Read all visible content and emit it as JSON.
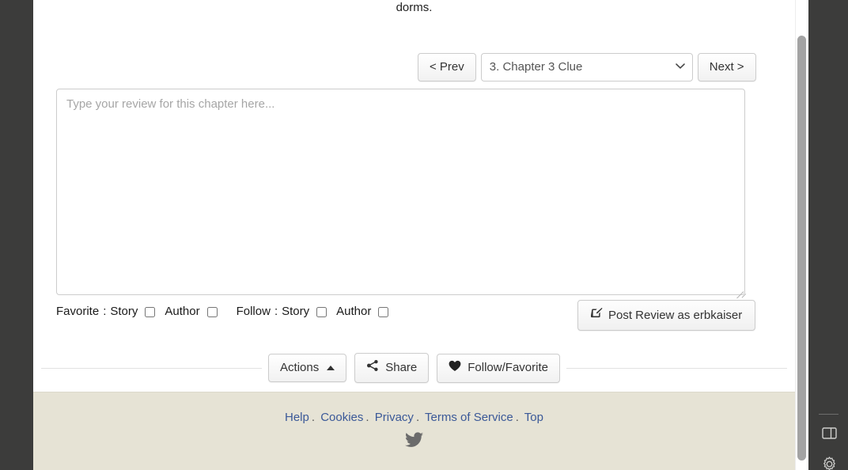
{
  "story": {
    "trailing_text": "dorms."
  },
  "chapter_nav": {
    "prev_label": "< Prev",
    "next_label": "Next >",
    "selected_chapter": "3. Chapter 3 Clue",
    "caret_icon": "chevron-down-icon"
  },
  "review": {
    "placeholder": "Type your review for this chapter here...",
    "value": ""
  },
  "options": {
    "favorite_label": "Favorite",
    "follow_label": "Follow",
    "separator": ":",
    "story_label": "Story",
    "author_label": "Author"
  },
  "post_review": {
    "label": "Post Review as erbkaiser",
    "icon": "pencil-square-icon"
  },
  "actions": {
    "actions_label": "Actions",
    "share_label": "Share",
    "follow_favorite_label": "Follow/Favorite",
    "actions_caret_icon": "caret-up-icon",
    "share_icon": "share-nodes-icon",
    "heart_icon": "heart-icon"
  },
  "footer": {
    "links": [
      {
        "label": "Help"
      },
      {
        "label": "Cookies"
      },
      {
        "label": "Privacy"
      },
      {
        "label": "Terms of Service"
      },
      {
        "label": "Top"
      }
    ],
    "separator": ".",
    "social_icon": "twitter-bird-icon"
  },
  "browser_chrome": {
    "panel_icon": "split-panel-icon",
    "settings_icon": "gear-icon"
  },
  "colors": {
    "rail": "#3c3c3b",
    "footer_bg": "#e6e3d5",
    "link": "#3b5998",
    "scrollbar_thumb": "#a3a3a3"
  }
}
